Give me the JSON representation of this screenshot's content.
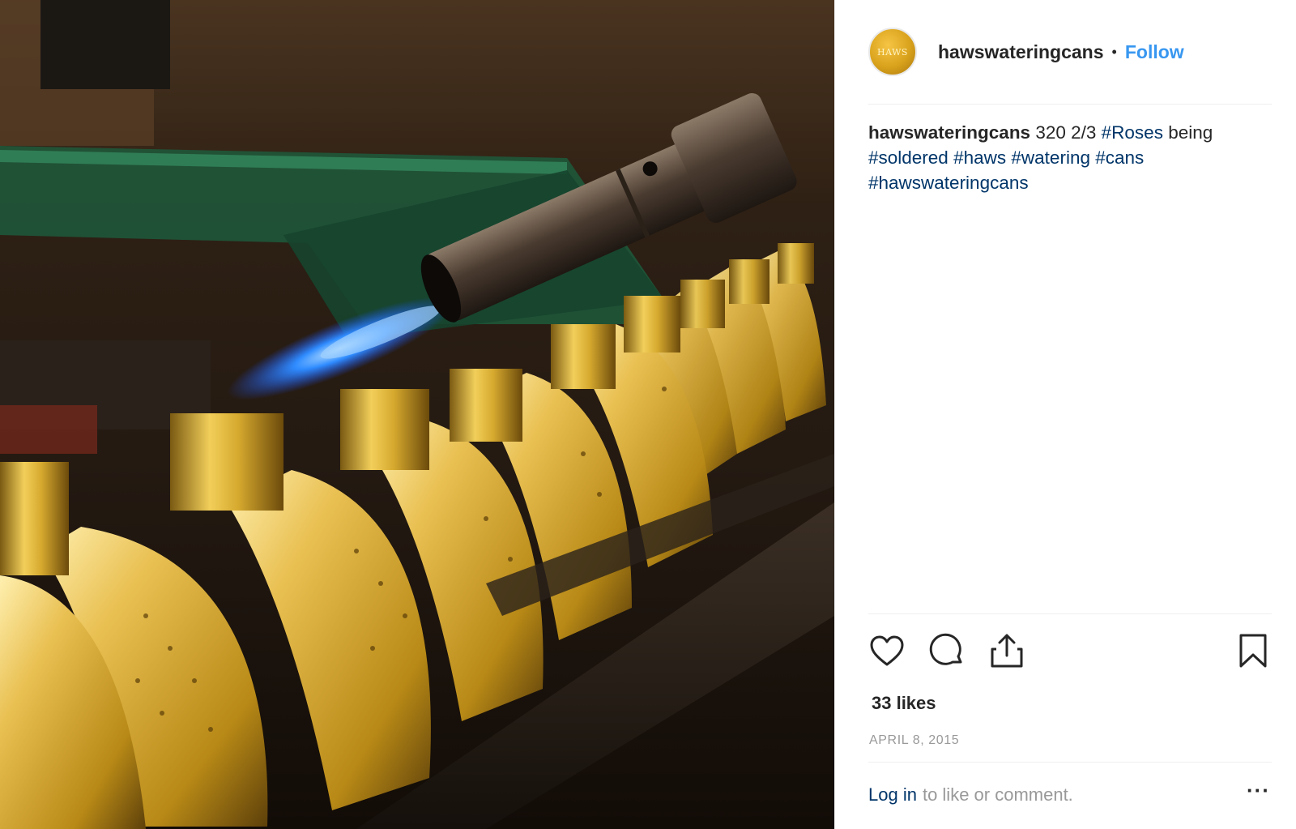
{
  "post": {
    "username": "hawswateringcans",
    "dot": "•",
    "follow_label": "Follow",
    "avatar_text": "HAWS",
    "caption": {
      "username": "hawswateringcans",
      "text": " 320 2/3 ",
      "tag_roses": "#Roses",
      "text_being": " being ",
      "tag_soldered": "#soldered",
      "tag_haws": "#haws",
      "tag_watering": "#watering",
      "tag_cans": "#cans",
      "tag_hawswateringcans": "#hawswateringcans"
    },
    "likes": "33 likes",
    "date": "APRIL 8, 2015",
    "login_link": "Log in",
    "login_rest": "to like or comment.",
    "more_label": "···"
  },
  "icons": {
    "like": "heart-icon",
    "comment": "comment-icon",
    "share": "share-icon",
    "save": "bookmark-icon",
    "more": "more-options-icon"
  },
  "colors": {
    "link_blue": "#3897f0",
    "hashtag": "#003569",
    "muted": "#999999",
    "text": "#262626",
    "divider": "#efefef"
  }
}
